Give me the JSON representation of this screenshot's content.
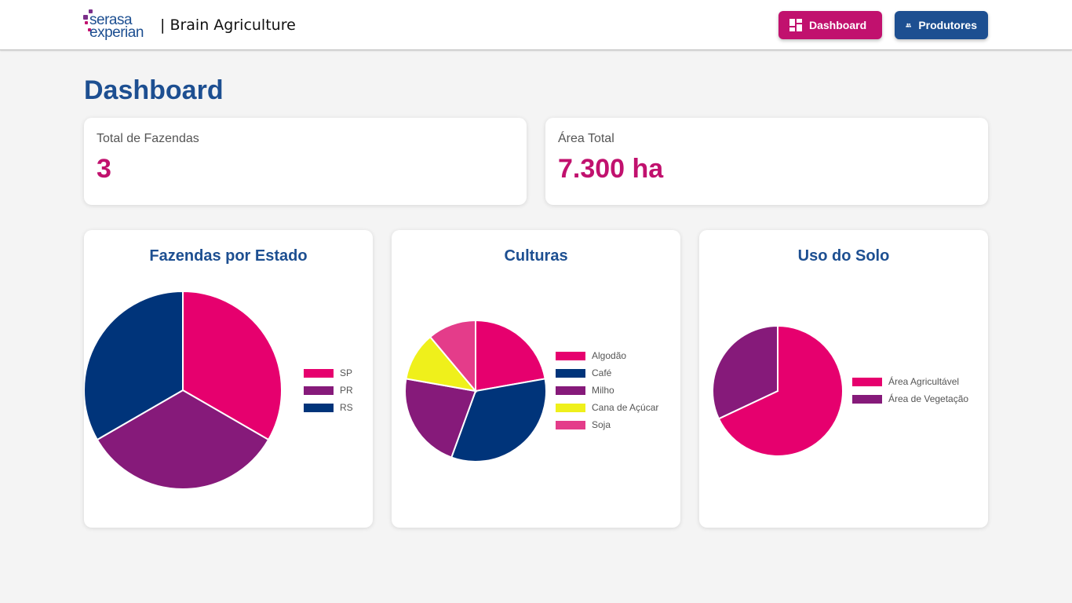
{
  "header": {
    "logo_line1": "serasa",
    "logo_line2": "experian",
    "app_title": "| Brain Agriculture",
    "nav": {
      "dashboard_label": "Dashboard",
      "produtores_label": "Produtores"
    }
  },
  "page": {
    "title": "Dashboard"
  },
  "stats": [
    {
      "label": "Total de Fazendas",
      "value": "3"
    },
    {
      "label": "Área Total",
      "value": "7.300 ha"
    }
  ],
  "colors": {
    "brand_blue": "#1d4f91",
    "brand_magenta": "#c1116e",
    "pink": "#e6006e",
    "purple": "#861a7a",
    "navy": "#00347a",
    "yellow": "#eff01b",
    "light_pink": "#e43c8a"
  },
  "chart_data": [
    {
      "type": "pie",
      "title": "Fazendas por Estado",
      "categories": [
        "SP",
        "PR",
        "RS"
      ],
      "values": [
        1,
        1,
        1
      ],
      "colors": [
        "#e6006e",
        "#861a7a",
        "#00347a"
      ],
      "legend": "right"
    },
    {
      "type": "pie",
      "title": "Culturas",
      "categories": [
        "Algodão",
        "Café",
        "Milho",
        "Cana de Açúcar",
        "Soja"
      ],
      "values": [
        2,
        3,
        2,
        1,
        1
      ],
      "colors": [
        "#e6006e",
        "#00347a",
        "#861a7a",
        "#eff01b",
        "#e43c8a"
      ],
      "legend": "right"
    },
    {
      "type": "pie",
      "title": "Uso do Solo",
      "categories": [
        "Área Agricultável",
        "Área de Vegetação"
      ],
      "values": [
        68,
        32
      ],
      "colors": [
        "#e6006e",
        "#861a7a"
      ],
      "legend": "right"
    }
  ]
}
